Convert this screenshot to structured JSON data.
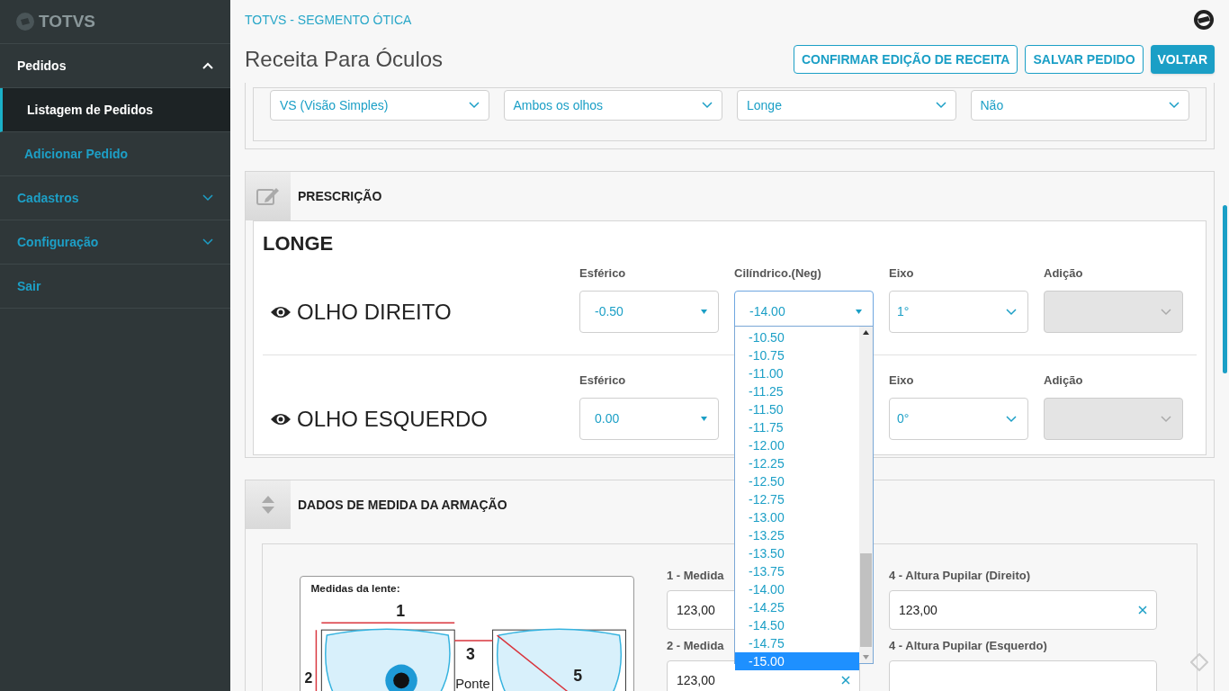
{
  "sidebar": {
    "logo": "TOTVS",
    "items": [
      {
        "label": "Pedidos",
        "expanded": true,
        "children": [
          {
            "label": "Listagem de Pedidos",
            "selected": true
          },
          {
            "label": "Adicionar Pedido",
            "selected": false
          }
        ]
      },
      {
        "label": "Cadastros",
        "expanded": false
      },
      {
        "label": "Configuração",
        "expanded": false
      },
      {
        "label": "Sair"
      }
    ]
  },
  "header": {
    "app_name": "TOTVS - SEGMENTO ÓTICA",
    "title": "Receita Para Óculos",
    "buttons": [
      {
        "label": "CONFIRMAR EDIÇÃO DE RECEITA",
        "primary": false
      },
      {
        "label": "SALVAR PEDIDO",
        "primary": false
      },
      {
        "label": "VOLTAR",
        "primary": true
      }
    ]
  },
  "top_selects": [
    "VS (Visão Simples)",
    "Ambos os olhos",
    "Longe",
    "Não"
  ],
  "prescription": {
    "title": "PRESCRIÇÃO",
    "distance": "LONGE",
    "eyes": [
      {
        "label": "OLHO DIREITO",
        "fields": [
          {
            "kind": "native",
            "label": "Esférico",
            "value": "-0.50",
            "open": false
          },
          {
            "kind": "native",
            "label": "Cilíndrico.(Neg)",
            "value": "-14.00",
            "open": true
          },
          {
            "kind": "chevron",
            "label": "Eixo",
            "value": "1°"
          },
          {
            "kind": "disabled",
            "label": "Adição"
          }
        ]
      },
      {
        "label": "OLHO ESQUERDO",
        "fields": [
          {
            "kind": "native",
            "label": "Esférico",
            "value": "0.00",
            "open": false
          },
          {
            "kind": "covered"
          },
          {
            "kind": "chevron",
            "label": "Eixo",
            "value": "0°"
          },
          {
            "kind": "disabled",
            "label": "Adição"
          }
        ]
      }
    ]
  },
  "dropdown": [
    {
      "label": "-10.50",
      "selected": false
    },
    {
      "label": "-10.75",
      "selected": false
    },
    {
      "label": "-11.00",
      "selected": false
    },
    {
      "label": "-11.25",
      "selected": false
    },
    {
      "label": "-11.50",
      "selected": false
    },
    {
      "label": "-11.75",
      "selected": false
    },
    {
      "label": "-12.00",
      "selected": false
    },
    {
      "label": "-12.25",
      "selected": false
    },
    {
      "label": "-12.50",
      "selected": false
    },
    {
      "label": "-12.75",
      "selected": false
    },
    {
      "label": "-13.00",
      "selected": false
    },
    {
      "label": "-13.25",
      "selected": false
    },
    {
      "label": "-13.50",
      "selected": false
    },
    {
      "label": "-13.75",
      "selected": false
    },
    {
      "label": "-14.00",
      "selected": false
    },
    {
      "label": "-14.25",
      "selected": false
    },
    {
      "label": "-14.50",
      "selected": false
    },
    {
      "label": "-14.75",
      "selected": false
    },
    {
      "label": "-15.00",
      "selected": true
    }
  ],
  "frame": {
    "title": "DADOS DE MEDIDA DA ARMAÇÃO",
    "diagram": {
      "title": "Medidas da lente:",
      "labels": [
        "1",
        "2",
        "3",
        "Ponte",
        "5"
      ]
    },
    "columns": [
      [
        {
          "label": "1 - Medida",
          "value": "123,00"
        },
        {
          "label": "2 - Medida",
          "value": "123,00",
          "clearable": true
        }
      ],
      [
        {
          "label": "4 - Altura Pupilar (Direito)",
          "value": "123,00",
          "clearable": true
        },
        {
          "label": "4 - Altura Pupilar (Esquerdo)",
          "clearable": false
        }
      ]
    ]
  }
}
